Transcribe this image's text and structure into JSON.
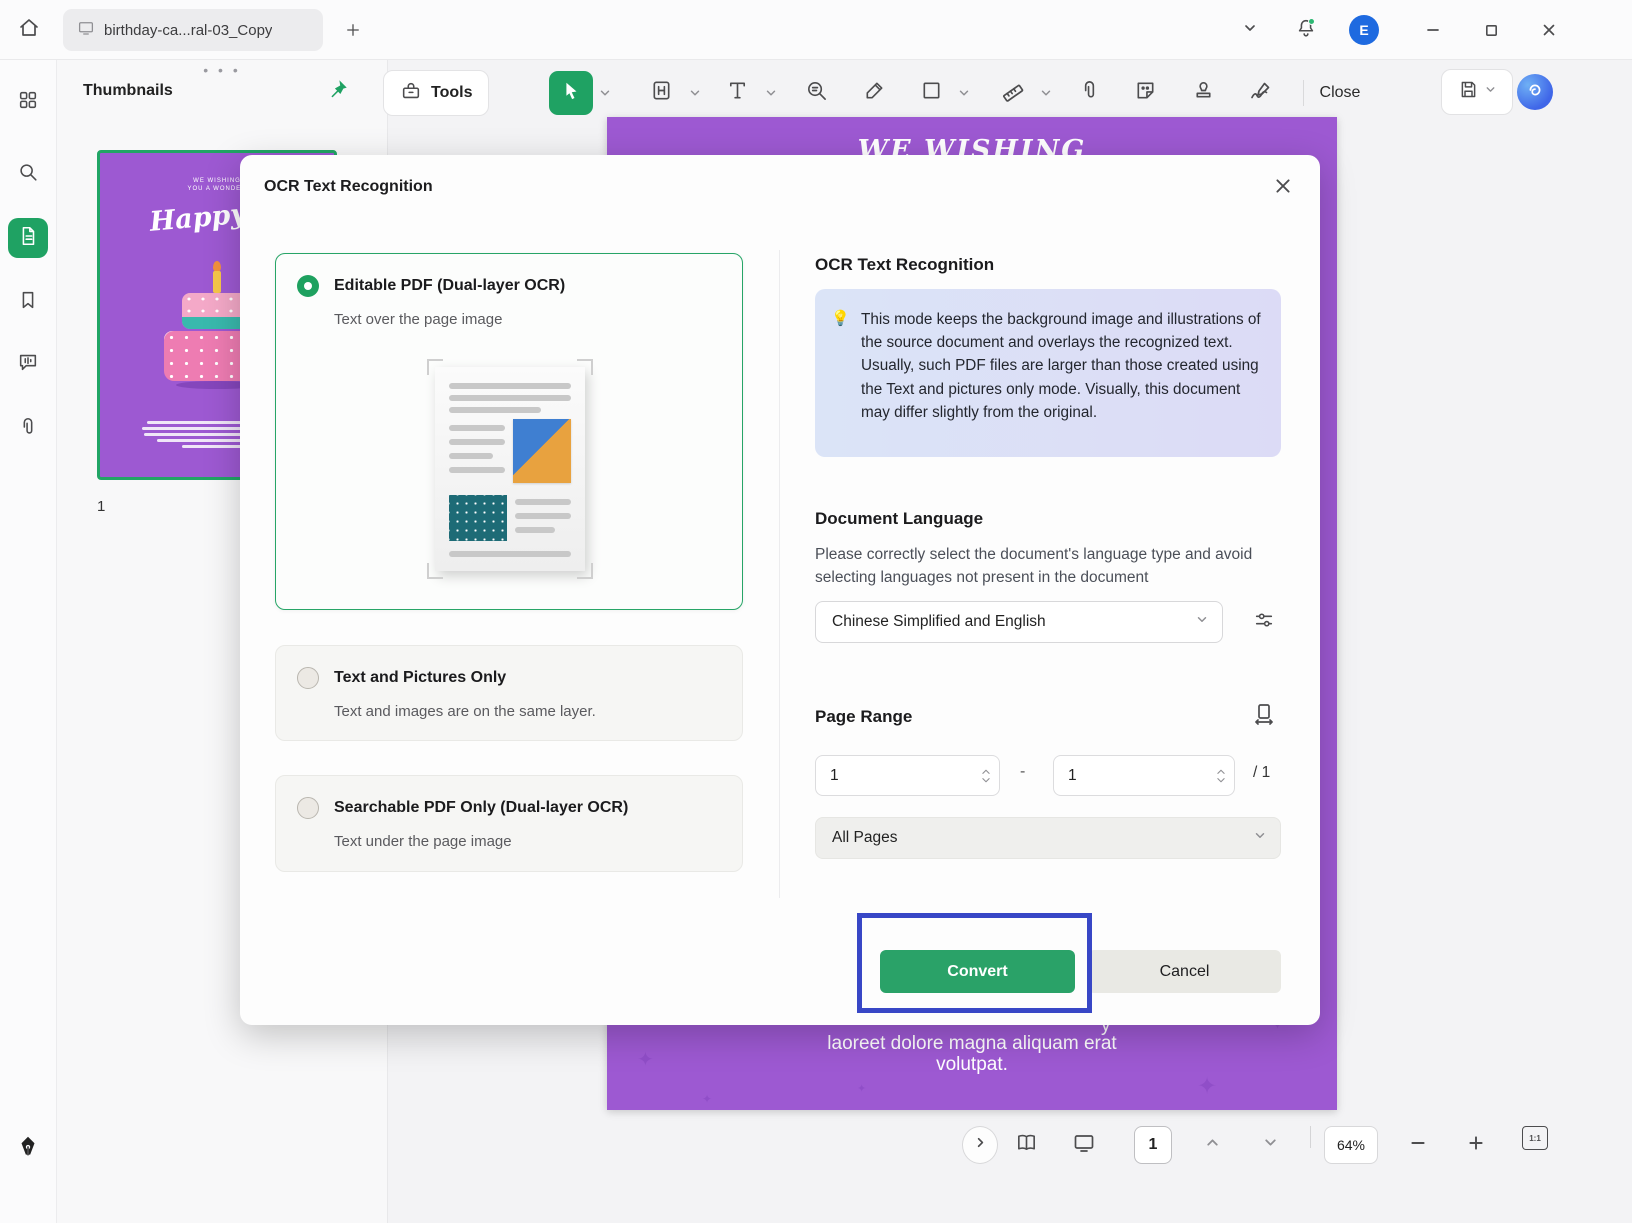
{
  "titlebar": {
    "tab_title": "birthday-ca...ral-03_Copy",
    "avatar_initial": "E"
  },
  "thumbnails_panel": {
    "title": "Thumbnails",
    "page_number": "1"
  },
  "thumbnail_card": {
    "line1": "WE WISHING",
    "line2": "YOU A WONDER",
    "headline": "Happy bi"
  },
  "toolbar": {
    "tools_label": "Tools",
    "close_label": "Close"
  },
  "canvas": {
    "heading": "WE WISHING",
    "partial_line": "y",
    "body_line1": "laoreet dolore magna aliquam erat",
    "body_line2": "volutpat."
  },
  "dialog": {
    "title": "OCR Text Recognition",
    "options": [
      {
        "label": "Editable PDF (Dual-layer OCR)",
        "desc": "Text over the page image",
        "selected": true
      },
      {
        "label": "Text and Pictures Only",
        "desc": "Text and images are on the same layer.",
        "selected": false
      },
      {
        "label": "Searchable PDF Only (Dual-layer OCR)",
        "desc": "Text under the page image",
        "selected": false
      }
    ],
    "panel": {
      "heading": "OCR Text Recognition",
      "info_icon": "💡",
      "info_text": "This mode keeps the background image and illustrations of the source document and overlays the recognized text. Usually, such PDF files are larger than those created using the Text and pictures only mode. Visually, this document may differ slightly from the original.",
      "language_heading": "Document Language",
      "language_hint": "Please correctly select the document's language type and avoid selecting languages not present in the document",
      "language_value": "Chinese Simplified and English",
      "page_range_heading": "Page Range",
      "range_from": "1",
      "range_to": "1",
      "range_separator": "-",
      "range_total": "/ 1",
      "range_mode": "All Pages",
      "convert_label": "Convert",
      "cancel_label": "Cancel"
    }
  },
  "statusbar": {
    "page_value": "1",
    "zoom_value": "64%",
    "actual_size_label": "1:1"
  },
  "icons": {
    "home": "home-icon",
    "apps": "apps-grid-icon",
    "search": "search-icon",
    "pages": "page-thumbnails-icon",
    "bookmark": "bookmark-icon",
    "comment": "comment-icon",
    "attachment": "paperclip-icon",
    "pin": "pin-icon",
    "select": "cursor-icon",
    "ai": "ai-assistant-icon",
    "save": "save-icon",
    "bell": "notifications-icon"
  },
  "colors": {
    "accent_green": "#1fa263",
    "page_purple": "#9d59d2",
    "highlight_blue": "#3847c6",
    "avatar_blue": "#1e6ae0",
    "info_box_gradient_start": "#dbe4f7",
    "info_box_gradient_end": "#dcdbf6"
  }
}
